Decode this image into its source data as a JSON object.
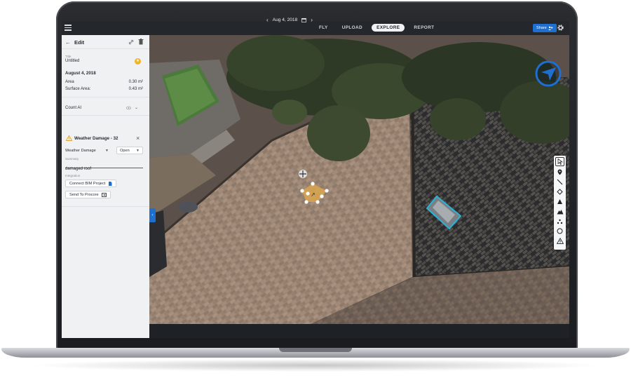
{
  "topbar": {
    "tabs": [
      {
        "label": "FLY",
        "active": false
      },
      {
        "label": "UPLOAD",
        "active": false
      },
      {
        "label": "EXPLORE",
        "active": true
      },
      {
        "label": "REPORT",
        "active": false
      }
    ],
    "share_label": "Share"
  },
  "date_nav": {
    "date": "Aug 4, 2018"
  },
  "panel": {
    "header_title": "Edit",
    "title_label": "Title",
    "title_value": "Untitled",
    "date": "August 4, 2018",
    "area_label": "Area",
    "area_value": "0.30 m²",
    "surface_label": "Surface Area:",
    "surface_value": "0.43 m²",
    "count_ai_label": "Count AI",
    "issue_title": "Weather Damage - 32",
    "category_value": "Weather Damage",
    "status_value": "Open",
    "summary_label": "Summary",
    "summary_value": "damaged roof",
    "integration_label": "Integration",
    "connect_bim_label": "Connect BIM Project",
    "send_procore_label": "Send To Procore"
  },
  "colors": {
    "accent": "#1e6fd0",
    "annotation": "#d9a650",
    "selection_box": "#2bb3d9",
    "star": "#f0b429"
  },
  "icons": [
    "menu-icon",
    "share-icon",
    "gear-icon",
    "back-arrow-icon",
    "link-icon",
    "trash-icon",
    "star-icon",
    "eye-icon",
    "chevron-down-icon",
    "warning-icon",
    "close-icon",
    "calendar-icon",
    "compass-icon",
    "cursor-tool-icon",
    "pin-tool-icon",
    "line-tool-icon",
    "polygon-tool-icon",
    "volume-tool-icon",
    "stockpile-tool-icon",
    "count-tool-icon",
    "circle-tool-icon",
    "warning-tool-icon"
  ]
}
